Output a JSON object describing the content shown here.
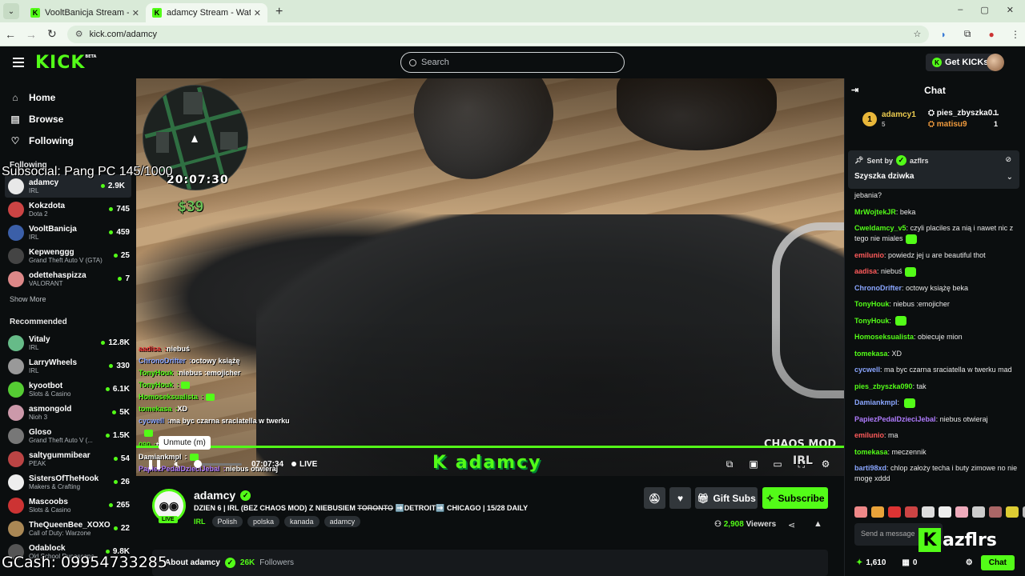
{
  "browser": {
    "tabs": [
      {
        "title": "VooltBanicja Stream - Watch Li...",
        "active": false
      },
      {
        "title": "adamcy Stream - Watch Live on...",
        "active": true
      }
    ],
    "url": "kick.com/adamcy",
    "window_controls": [
      "–",
      "▢",
      "✕"
    ]
  },
  "topnav": {
    "logo": "KICK",
    "logo_beta": "BETA",
    "search_placeholder": "Search",
    "get_kicks": "Get KICKs"
  },
  "sidebar": {
    "nav": [
      {
        "label": "Home",
        "icon": "home-icon"
      },
      {
        "label": "Browse",
        "icon": "browse-icon"
      },
      {
        "label": "Following",
        "icon": "heart-icon"
      }
    ],
    "following_title": "Following",
    "following": [
      {
        "name": "adamcy",
        "category": "IRL",
        "viewers": "2.9K",
        "color": "#e8e8e8"
      },
      {
        "name": "Kokzdota",
        "category": "Dota 2",
        "viewers": "745",
        "color": "#c44"
      },
      {
        "name": "VooltBanicja",
        "category": "IRL",
        "viewers": "459",
        "color": "#3b5fa8"
      },
      {
        "name": "Kepwenggg",
        "category": "Grand Theft Auto V (GTA)",
        "viewers": "25",
        "color": "#444"
      },
      {
        "name": "odettehaspizza",
        "category": "VALORANT",
        "viewers": "7",
        "color": "#d88"
      }
    ],
    "show_more": "Show More",
    "recommended_title": "Recommended",
    "recommended": [
      {
        "name": "Vitaly",
        "category": "IRL",
        "viewers": "12.8K",
        "color": "#6b8"
      },
      {
        "name": "LarryWheels",
        "category": "IRL",
        "viewers": "330",
        "color": "#999"
      },
      {
        "name": "kyootbot",
        "category": "Slots & Casino",
        "viewers": "6.1K",
        "color": "#5c3"
      },
      {
        "name": "asmongold",
        "category": "Nioh 3",
        "viewers": "5K",
        "color": "#c9a"
      },
      {
        "name": "Gloso",
        "category": "Grand Theft Auto V (...",
        "viewers": "1.5K",
        "color": "#777"
      },
      {
        "name": "saltygummibear",
        "category": "PEAK",
        "viewers": "54",
        "color": "#b44"
      },
      {
        "name": "SistersOfTheHook",
        "category": "Makers & Crafting",
        "viewers": "26",
        "color": "#eee"
      },
      {
        "name": "Mascoobs",
        "category": "Slots & Casino",
        "viewers": "265",
        "color": "#c33"
      },
      {
        "name": "TheQueenBee_XOXO",
        "category": "Call of Duty: Warzone",
        "viewers": "22",
        "color": "#a85"
      },
      {
        "name": "Odablock",
        "category": "Old School Runescape",
        "viewers": "9.8K",
        "color": "#555"
      }
    ]
  },
  "video": {
    "clock": "20:07:30",
    "money": "$39",
    "overlay_chat": [
      {
        "user": "aadisa",
        "text": "niebuś",
        "color": "#e33"
      },
      {
        "user": "ChronoDrifter",
        "text": "octowy książę",
        "color": "#8aa6ff"
      },
      {
        "user": "TonyHouk",
        "text": "niebus :emojicher",
        "color": "#53fc18"
      },
      {
        "user": "TonyHouk",
        "text": "",
        "color": "#53fc18"
      },
      {
        "user": "Homoseksualista",
        "text": "",
        "color": "#53fc18"
      },
      {
        "user": "tomekasa",
        "text": "XD",
        "color": "#53fc18"
      },
      {
        "user": "cycwell",
        "text": "ma byc czarna sraciatella w twerku",
        "color": "#8aa6ff"
      },
      {
        "user": "",
        "text": "",
        "color": "#fff"
      },
      {
        "user": "090",
        "text": "tak",
        "color": "#53fc18"
      },
      {
        "user": "Damiankmpl",
        "text": "",
        "color": "#fff"
      },
      {
        "user": "PapiezPedalDzieciJebal",
        "text": "niebus otwieraj",
        "color": "#b07cff"
      }
    ],
    "tooltip": "Unmute (m)",
    "timecode": "07:07:34",
    "live_label": "LIVE",
    "watermark": "adamcy",
    "chaos_mod": "CHAOS MOD",
    "irl": "IRL",
    "volume_level": 0
  },
  "stream": {
    "name": "adamcy",
    "title_pre": "DZIEN 6 | IRL (BEZ CHAOS MOD) Z NIEBUSIEM ",
    "title_strike": "TORONTO",
    "title_post": " ➡️DETROIT➡️ CHICAGO | 15/28 DAILY",
    "category": "IRL",
    "tags": [
      "Polish",
      "polska",
      "kanada",
      "adamcy"
    ],
    "live_badge": "LIVE",
    "gift_subs": "Gift Subs",
    "subscribe": "Subscribe",
    "viewers": "2,908",
    "viewers_label": "Viewers",
    "about": "About adamcy",
    "followers": "26K",
    "followers_label": "Followers"
  },
  "chat": {
    "title": "Chat",
    "leaderboard": [
      {
        "rank": "1",
        "user": "adamcy1",
        "sub": "5",
        "count": "1"
      },
      {
        "user": "pies_zbyszka0...",
        "count": "1"
      },
      {
        "user": "matisu9",
        "count": "1"
      }
    ],
    "pinned": {
      "sent_by": "Sent by",
      "user": "azflrs",
      "message": "Szyszka dziwka"
    },
    "messages": [
      {
        "user": "",
        "text": "jebania?",
        "color": "#fff"
      },
      {
        "user": "MrWojtekJR",
        "text": "beka",
        "color": "#53fc18"
      },
      {
        "user": "Cweldamcy_v5",
        "text": "czyli placiles za nią i nawet nic z tego nie miales",
        "color": "#53fc18",
        "emote": true
      },
      {
        "user": "emilunio",
        "text": "powiedz jej u are beautiful thot",
        "color": "#ff5b5b"
      },
      {
        "user": "aadisa",
        "text": "niebuś",
        "color": "#ff5b5b",
        "emote": true
      },
      {
        "user": "ChronoDrifter",
        "text": "octowy książę beka",
        "color": "#8aa6ff"
      },
      {
        "user": "TonyHouk",
        "text": "niebus :emojicher",
        "color": "#53fc18"
      },
      {
        "user": "TonyHouk",
        "text": "",
        "color": "#53fc18",
        "emote": true
      },
      {
        "user": "Homoseksualista",
        "text": "obiecuje mion",
        "color": "#53fc18"
      },
      {
        "user": "tomekasa",
        "text": "XD",
        "color": "#53fc18"
      },
      {
        "user": "cycwell",
        "text": "ma byc czarna sraciatella w twerku mad",
        "color": "#8aa6ff"
      },
      {
        "user": "pies_zbyszka090",
        "text": "tak",
        "color": "#53fc18"
      },
      {
        "user": "Damiankmpl",
        "text": "",
        "color": "#8aa6ff",
        "emote": true
      },
      {
        "user": "PapiezPedalDzieciJebal",
        "text": "niebus otwieraj",
        "color": "#b07cff"
      },
      {
        "user": "emilunio",
        "text": "ma",
        "color": "#ff5b5b"
      },
      {
        "user": "tomekasa",
        "text": "meczennik",
        "color": "#53fc18"
      },
      {
        "user": "barti98xd",
        "text": "chlop założy techa i buty zimowe no nie mogę xddd",
        "color": "#8aa6ff"
      }
    ],
    "emote_colors": [
      "#e88",
      "#e9a33a",
      "#d33",
      "#c44",
      "#ddd",
      "#eee",
      "#eab",
      "#ccc",
      "#a66",
      "#dc3",
      "#bbb",
      "#ccd"
    ],
    "input_placeholder": "Send a message",
    "overlay_brand": "azflrs",
    "points": "1,610",
    "gifts": "0",
    "send": "Chat"
  },
  "overlays": {
    "subsocial": "Subsocial: Pang PC 145/1000",
    "gcash": "GCash: 09954733285"
  }
}
